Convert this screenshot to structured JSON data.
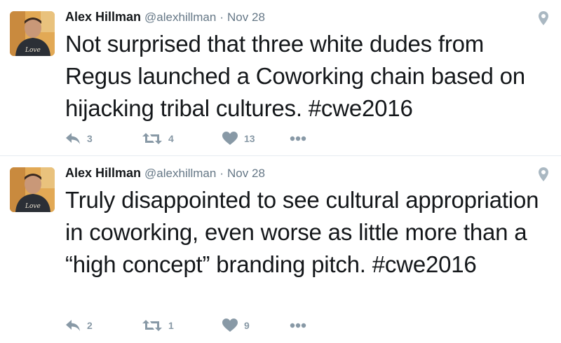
{
  "colors": {
    "text": "#14171a",
    "meta": "#657786",
    "action": "#8899a6",
    "divider": "#e6ecf0"
  },
  "tweets": [
    {
      "author_name": "Alex Hillman",
      "handle": "@alexhillman",
      "separator": "·",
      "time": "Nov 28",
      "text": "Not surprised that three white dudes from Regus launched a Coworking chain based on hijacking tribal cultures. #cwe2016",
      "reply_count": "3",
      "retweet_count": "4",
      "like_count": "13"
    },
    {
      "author_name": "Alex Hillman",
      "handle": "@alexhillman",
      "separator": "·",
      "time": "Nov 28",
      "text": "Truly disappointed to see cultural appropriation in coworking, even worse as little more than a “high concept” branding pitch. #cwe2016",
      "reply_count": "2",
      "retweet_count": "1",
      "like_count": "9"
    }
  ],
  "icons": {
    "avatar": "avatar-photo",
    "location": "location-pin-icon",
    "reply": "reply-arrow-icon",
    "retweet": "retweet-icon",
    "like": "heart-icon",
    "more": "more-dots-icon"
  }
}
